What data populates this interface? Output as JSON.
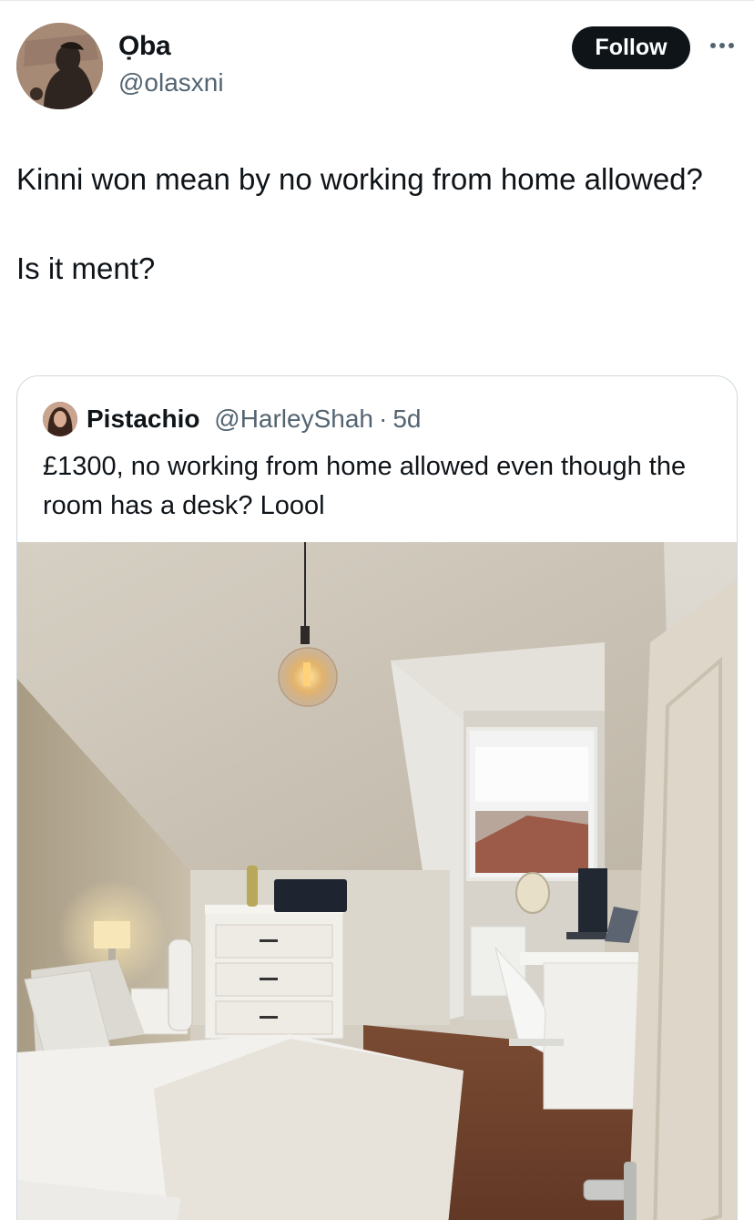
{
  "tweet": {
    "author": {
      "display_name": "Ọba",
      "handle": "@olasxni",
      "avatar_icon": "avatar-profile-photo"
    },
    "follow_label": "Follow",
    "more_icon": "more-horizontal-icon",
    "text_lines": [
      "Kinni won mean by no working from home allowed?",
      "Is it ment?"
    ]
  },
  "quoted_tweet": {
    "author": {
      "display_name": "Pistachio",
      "handle": "@HarleyShah",
      "separator": "·",
      "time": "5d"
    },
    "text": "£1300, no working from home allowed even though the room has a desk? Loool",
    "media_icon": "bedroom-photo"
  },
  "colors": {
    "text_primary": "#0f1419",
    "text_secondary": "#536471",
    "follow_bg": "#0f1419",
    "border": "#cfd9de"
  }
}
